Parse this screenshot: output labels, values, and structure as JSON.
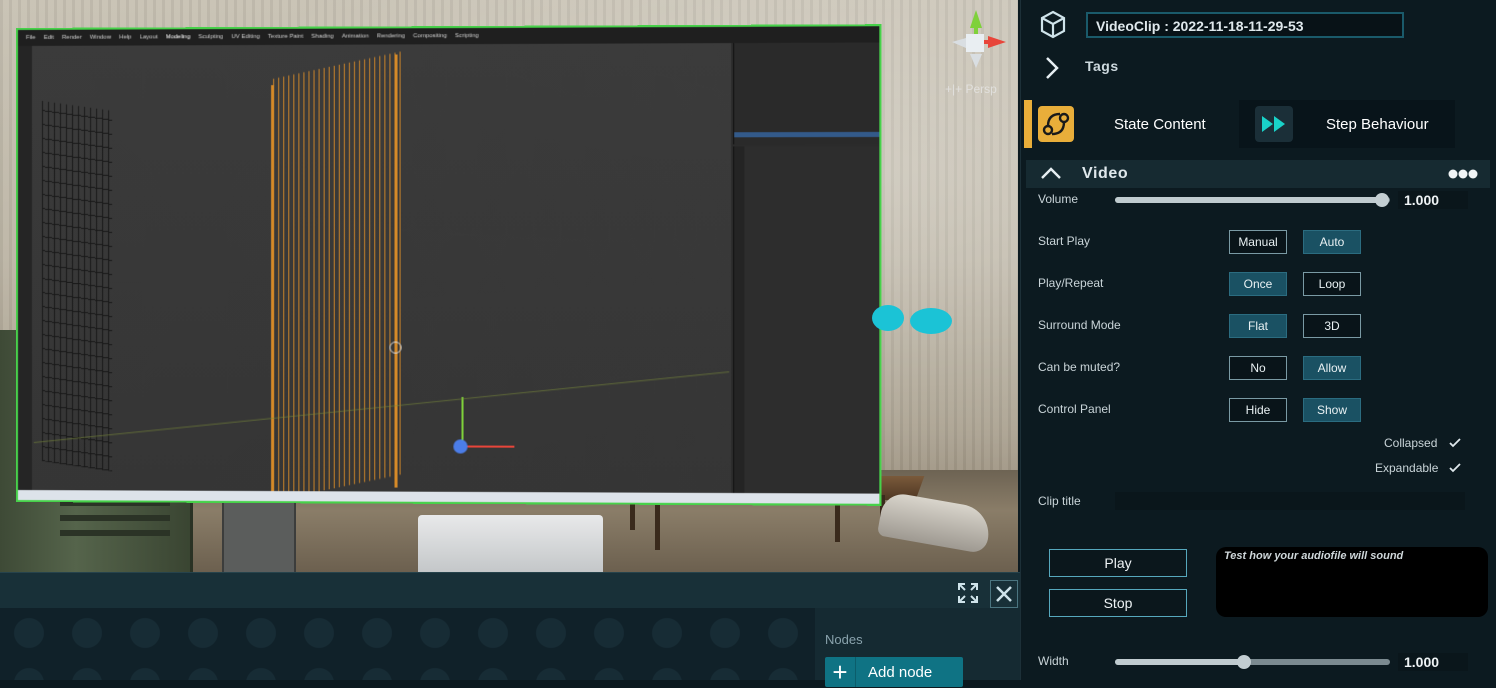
{
  "viewport": {
    "persp_label": "+|+ Persp",
    "screen_menu": [
      "File",
      "Edit",
      "Render",
      "Window",
      "Help",
      "Layout",
      "Modeling",
      "Sculpting",
      "UV Editing",
      "Texture Paint",
      "Shading",
      "Animation",
      "Rendering",
      "Compositing",
      "Scripting"
    ]
  },
  "bottom_bar": {
    "nodes_label": "Nodes",
    "add_node_label": "Add node"
  },
  "inspector": {
    "title_value": "VideoClip : 2022-11-18-11-29-53",
    "tags_label": "Tags",
    "tabs": {
      "state_content": "State Content",
      "step_behaviour": "Step Behaviour"
    },
    "section_title": "Video",
    "volume": {
      "label": "Volume",
      "value": "1.000",
      "fraction": 0.97
    },
    "start_play": {
      "label": "Start Play",
      "options": [
        "Manual",
        "Auto"
      ],
      "selected": "Auto"
    },
    "play_repeat": {
      "label": "Play/Repeat",
      "options": [
        "Once",
        "Loop"
      ],
      "selected": "Once"
    },
    "surround_mode": {
      "label": "Surround Mode",
      "options": [
        "Flat",
        "3D"
      ],
      "selected": "Flat"
    },
    "can_be_muted": {
      "label": "Can be muted?",
      "options": [
        "No",
        "Allow"
      ],
      "selected": "Allow"
    },
    "control_panel": {
      "label": "Control Panel",
      "options": [
        "Hide",
        "Show"
      ],
      "selected": "Show"
    },
    "collapsed_label": "Collapsed",
    "expandable_label": "Expandable",
    "clip_title": {
      "label": "Clip title",
      "value": ""
    },
    "play_button": "Play",
    "stop_button": "Stop",
    "info_text": "Test how your audiofile will sound",
    "width": {
      "label": "Width",
      "value": "1.000",
      "fraction": 0.47
    }
  },
  "colors": {
    "accent_orange": "#e9ae3a",
    "accent_teal": "#1a5163",
    "panel_bg": "#0c1a20",
    "screen_border": "#47d14a"
  }
}
